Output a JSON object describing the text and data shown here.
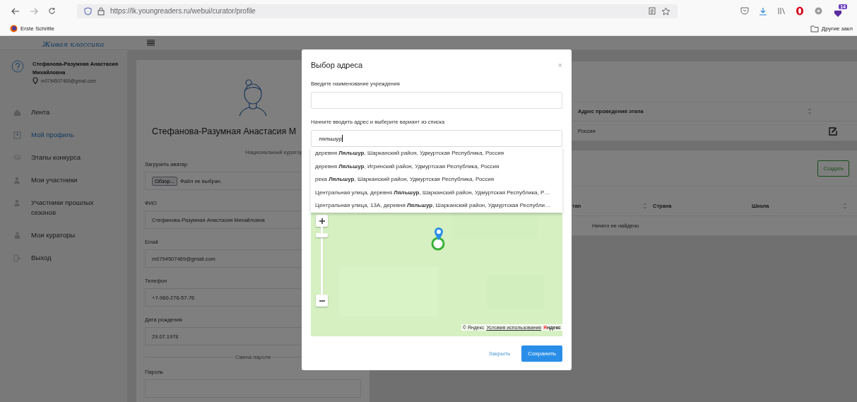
{
  "browser": {
    "url": "https://lk.youngreaders.ru/webui/curator/profile",
    "bookmarks": [
      "Erste Schritte"
    ],
    "other_bookmarks": "Другие закл",
    "extension_badge": "14"
  },
  "app": {
    "logo": "Живая классика",
    "user": {
      "name": "Стефанова-Разумная Анастасия Михайловна",
      "email": "m0794507469@gmail.com"
    },
    "nav": [
      {
        "label": "Лента",
        "selected": false
      },
      {
        "label": "Мой профиль",
        "selected": true
      },
      {
        "label": "Этапы конкурса",
        "selected": false
      },
      {
        "label": "Мои участники",
        "selected": false
      },
      {
        "label": "Участники прошлых сезонов",
        "selected": false
      },
      {
        "label": "Мои кураторы",
        "selected": false
      },
      {
        "label": "Выход",
        "selected": false
      }
    ]
  },
  "profile": {
    "name": "Стефанова-Разумная Анастасия М",
    "role": "Национальный куратор",
    "avatar_label": "Загрузить аватар",
    "file_button": "Обзор...",
    "file_status": "Файл не выбран.",
    "fields": [
      {
        "label": "ФИО",
        "value": "Стефанова-Разумная Анастасия Михайловна"
      },
      {
        "label": "Email",
        "value": "m0794507469@gmail.com"
      },
      {
        "label": "Телефон",
        "value": "+7-960-276-57-76"
      },
      {
        "label": "Дата рождения",
        "value": "29.07.1978"
      }
    ],
    "password_section": "Смена пароля",
    "password_label": "Пароль"
  },
  "stages_table": {
    "column_header": "Адрес проведения этапа",
    "rows": [
      {
        "address": "Россия"
      }
    ]
  },
  "participants": {
    "create_button": "Создать",
    "columns": [
      "тап",
      "Страна",
      "Школа"
    ],
    "empty": "Ничего не найдено"
  },
  "modal": {
    "title": "Выбор адреса",
    "close": "×",
    "institution_label": "Введите наименование учреждения",
    "address_label": "Начните вводить адрес и выберите вариант из списка",
    "address_value": "ляльшур",
    "suggestions": [
      "деревня **Ляльшур**, Шарканский район, Удмуртская Республика, Россия",
      "деревня **Ляльшур**, Игринский район, Удмуртская Республика, Россия",
      "река **Ляльшур**, Шарканский район, Удмуртская Республика, Россия",
      "Центральная улица, деревня **Ляльшур**, Шарканский район, Удмуртская Республика, Р…",
      "Центральная улица, 13А, деревня **Ляльшур**, Шарканский район, Удмуртская Республи…"
    ],
    "map_copyright": "© Яндекс",
    "map_terms": "Условия использования",
    "map_logo_first": "Я",
    "map_logo_rest": "ндекс",
    "close_button": "Закрыть",
    "save_button": "Сохранить"
  }
}
